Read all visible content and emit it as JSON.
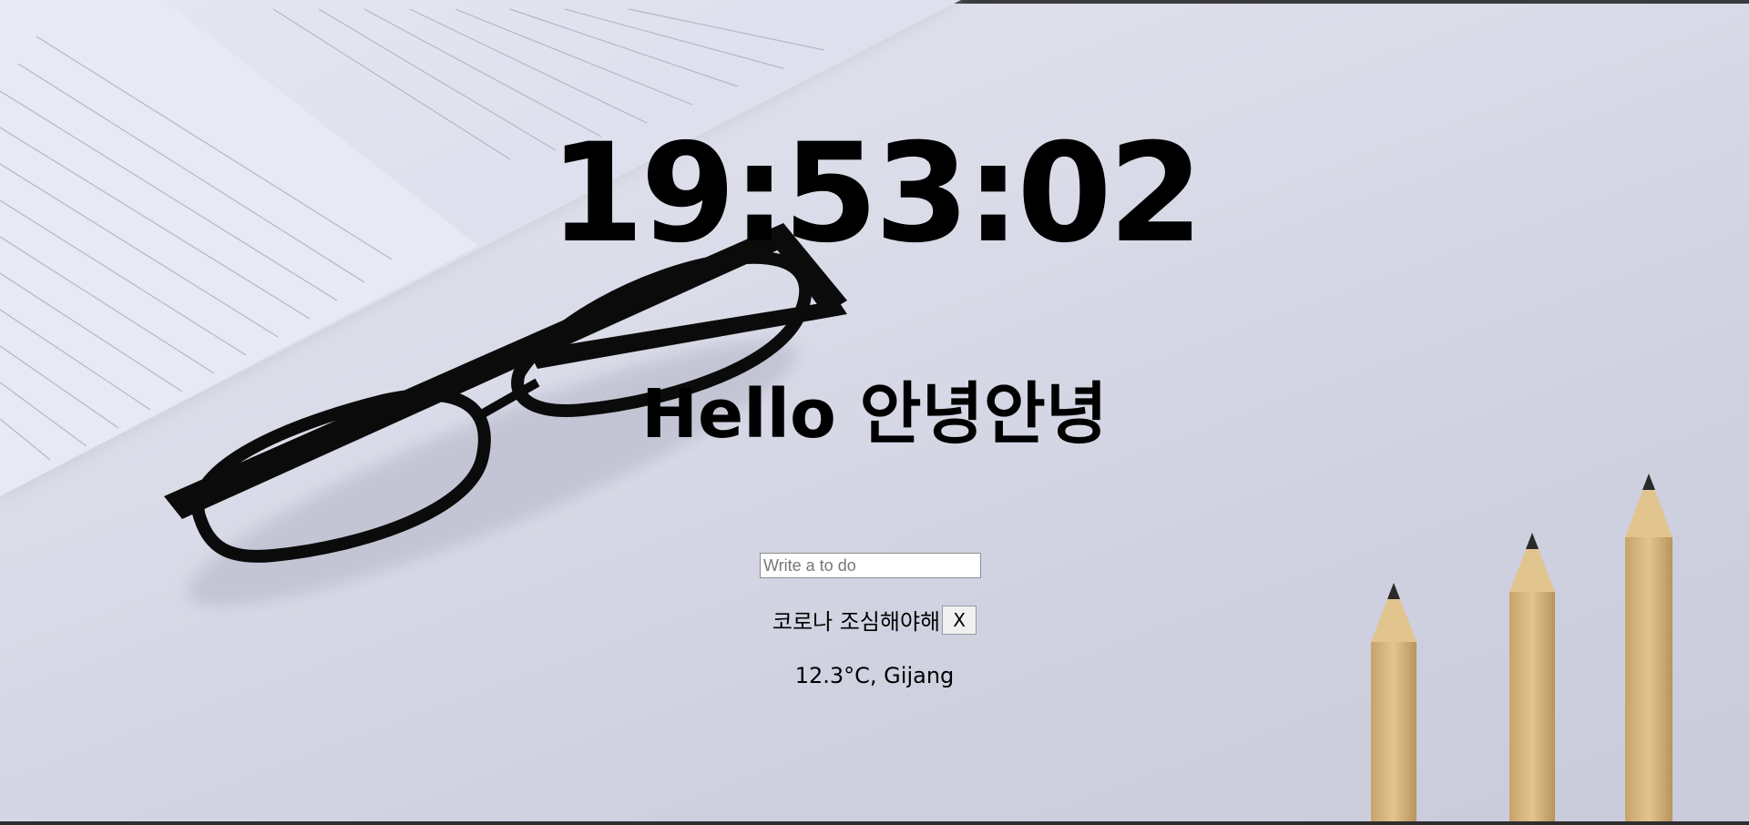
{
  "clock": {
    "time": "19:53:02"
  },
  "greeting": {
    "text": "Hello 안녕안녕"
  },
  "todo": {
    "placeholder": "Write a to do",
    "value": "",
    "items": [
      {
        "text": "코로나 조심해야해",
        "delete_label": "X"
      }
    ]
  },
  "weather": {
    "text": "12.3°C, Gijang"
  },
  "background": {
    "description_icon": "desk-photo",
    "colors": {
      "paper": "#dfe0ec",
      "desk": "#cfd1e0",
      "glasses": "#0a0a0a",
      "pencil_wood": "#d9b883",
      "pencil_lead": "#2a2a2a"
    }
  }
}
